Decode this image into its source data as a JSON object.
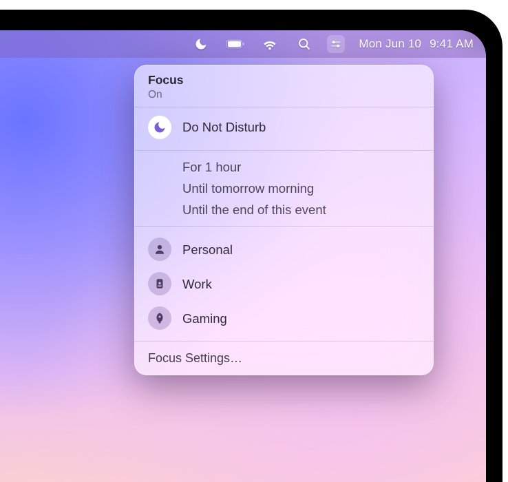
{
  "menubar": {
    "date": "Mon Jun 10",
    "time": "9:41 AM",
    "icons": {
      "focus": "moon-icon",
      "battery": "battery-icon",
      "wifi": "wifi-icon",
      "search": "search-icon",
      "control_center": "control-center-icon"
    }
  },
  "panel": {
    "title": "Focus",
    "status": "On",
    "active_mode": {
      "icon": "moon-icon",
      "label": "Do Not Disturb",
      "icon_color": "#7a5fd3"
    },
    "duration_options": [
      "For 1 hour",
      "Until tomorrow morning",
      "Until the end of this event"
    ],
    "modes": [
      {
        "icon": "person-icon",
        "label": "Personal"
      },
      {
        "icon": "badge-icon",
        "label": "Work"
      },
      {
        "icon": "rocket-icon",
        "label": "Gaming"
      }
    ],
    "footer": "Focus Settings…"
  },
  "colors": {
    "accent": "#7a5fd3",
    "inactive_circle": "rgba(123,95,160,.30)"
  }
}
